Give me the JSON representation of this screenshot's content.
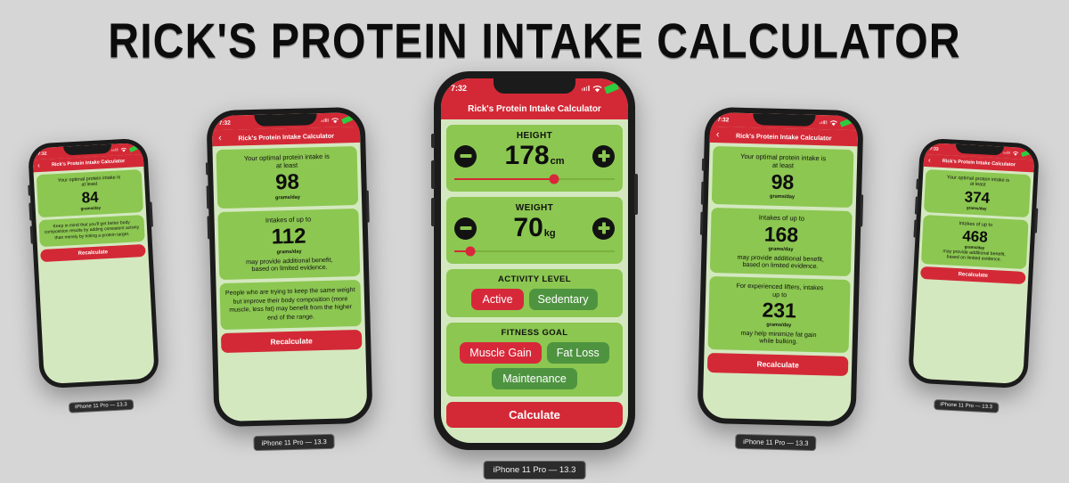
{
  "page": {
    "title": "RICK'S PROTEIN INTAKE CALCULATOR",
    "background_color": "#d6d6d6",
    "accent_red": "#d32936",
    "card_green": "#8cc751",
    "screen_green": "#d4e8c0",
    "segment_green": "#4e9440"
  },
  "device_label": "iPhone 11 Pro — 13.3",
  "nav_title": "Rick's Protein Intake Calculator",
  "back_icon": "‹",
  "phones": [
    {
      "id": "phone-1",
      "time": "7:32",
      "has_back": true,
      "cards": [
        {
          "type": "result",
          "lines_before": [
            "Your optimal protein intake is",
            "at least"
          ],
          "value": "84",
          "unit": "grams/day",
          "lines_after": []
        },
        {
          "type": "note",
          "text": "Keep in mind that you'll get better body composition results by adding consistent activity than merely by hitting a protein target."
        }
      ],
      "action_label": "Recalculate"
    },
    {
      "id": "phone-2",
      "time": "7:32",
      "has_back": true,
      "cards": [
        {
          "type": "result",
          "lines_before": [
            "Your optimal protein intake is",
            "at least"
          ],
          "value": "98",
          "unit": "grams/day",
          "lines_after": []
        },
        {
          "type": "result",
          "lines_before": [
            "Intakes of up to"
          ],
          "value": "112",
          "unit": "grams/day",
          "lines_after": [
            "may provide additional benefit,",
            "based on limited evidence."
          ]
        },
        {
          "type": "note",
          "text": "People who are trying to keep the same weight but improve their body composition (more muscle, less fat) may benefit from the higher end of the range."
        }
      ],
      "action_label": "Recalculate"
    },
    {
      "id": "phone-3-main",
      "time": "7:32",
      "has_back": false,
      "height": {
        "label": "HEIGHT",
        "value": "178",
        "unit": "cm",
        "slider_percent": 62,
        "minus_icon": "minus-circle-icon",
        "plus_icon": "plus-circle-icon"
      },
      "weight": {
        "label": "WEIGHT",
        "value": "70",
        "unit": "kg",
        "slider_percent": 10,
        "minus_icon": "minus-circle-icon",
        "plus_icon": "plus-circle-icon"
      },
      "activity": {
        "label": "ACTIVITY LEVEL",
        "options": [
          "Active",
          "Sedentary"
        ],
        "selected": "Active"
      },
      "goal": {
        "label": "FITNESS GOAL",
        "options": [
          "Muscle Gain",
          "Fat Loss",
          "Maintenance"
        ],
        "selected": "Muscle Gain"
      },
      "action_label": "Calculate"
    },
    {
      "id": "phone-4",
      "time": "7:32",
      "has_back": true,
      "cards": [
        {
          "type": "result",
          "lines_before": [
            "Your optimal protein intake is",
            "at least"
          ],
          "value": "98",
          "unit": "grams/day",
          "lines_after": []
        },
        {
          "type": "result",
          "lines_before": [
            "Intakes of up to"
          ],
          "value": "168",
          "unit": "grams/day",
          "lines_after": [
            "may provide additional benefit,",
            "based on limited evidence."
          ]
        },
        {
          "type": "result",
          "lines_before": [
            "For experienced lifters, intakes",
            "up to"
          ],
          "value": "231",
          "unit": "grams/day",
          "lines_after": [
            "may help minimize fat gain",
            "while bulking."
          ]
        }
      ],
      "action_label": "Recalculate"
    },
    {
      "id": "phone-5",
      "time": "7:33",
      "has_back": true,
      "cards": [
        {
          "type": "result",
          "lines_before": [
            "Your optimal protein intake is",
            "at least"
          ],
          "value": "374",
          "unit": "grams/day",
          "lines_after": []
        },
        {
          "type": "result",
          "lines_before": [
            "Intakes of up to"
          ],
          "value": "468",
          "unit": "grams/day",
          "lines_after": [
            "may provide additional benefit,",
            "based on limited evidence."
          ]
        }
      ],
      "action_label": "Recalculate"
    }
  ]
}
